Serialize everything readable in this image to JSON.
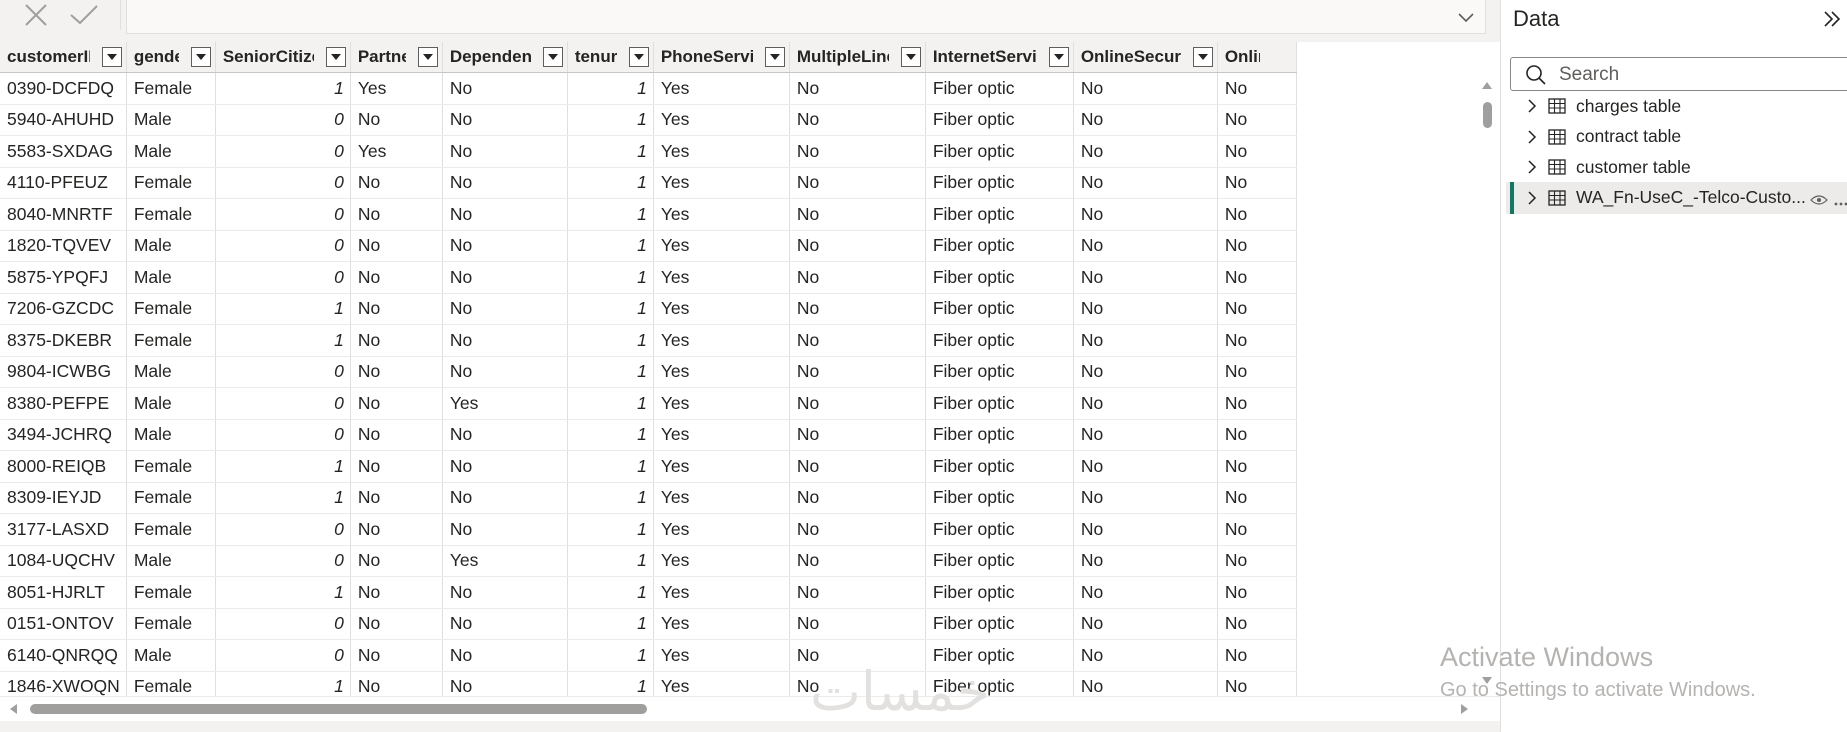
{
  "formula_bar": {
    "cancel_icon": "x-icon",
    "commit_icon": "checkmark-icon",
    "value": ""
  },
  "grid": {
    "columns": [
      "customerID",
      "gender",
      "SeniorCitizen",
      "Partner",
      "Dependents",
      "tenure",
      "PhoneService",
      "MultipleLines",
      "InternetService",
      "OnlineSecurity",
      "OnlineB"
    ],
    "rows": [
      [
        "0390-DCFDQ",
        "Female",
        "1",
        "Yes",
        "No",
        "1",
        "Yes",
        "No",
        "Fiber optic",
        "No",
        "No"
      ],
      [
        "5940-AHUHD",
        "Male",
        "0",
        "No",
        "No",
        "1",
        "Yes",
        "No",
        "Fiber optic",
        "No",
        "No"
      ],
      [
        "5583-SXDAG",
        "Male",
        "0",
        "Yes",
        "No",
        "1",
        "Yes",
        "No",
        "Fiber optic",
        "No",
        "No"
      ],
      [
        "4110-PFEUZ",
        "Female",
        "0",
        "No",
        "No",
        "1",
        "Yes",
        "No",
        "Fiber optic",
        "No",
        "No"
      ],
      [
        "8040-MNRTF",
        "Female",
        "0",
        "No",
        "No",
        "1",
        "Yes",
        "No",
        "Fiber optic",
        "No",
        "No"
      ],
      [
        "1820-TQVEV",
        "Male",
        "0",
        "No",
        "No",
        "1",
        "Yes",
        "No",
        "Fiber optic",
        "No",
        "No"
      ],
      [
        "5875-YPQFJ",
        "Male",
        "0",
        "No",
        "No",
        "1",
        "Yes",
        "No",
        "Fiber optic",
        "No",
        "No"
      ],
      [
        "7206-GZCDC",
        "Female",
        "1",
        "No",
        "No",
        "1",
        "Yes",
        "No",
        "Fiber optic",
        "No",
        "No"
      ],
      [
        "8375-DKEBR",
        "Female",
        "1",
        "No",
        "No",
        "1",
        "Yes",
        "No",
        "Fiber optic",
        "No",
        "No"
      ],
      [
        "9804-ICWBG",
        "Male",
        "0",
        "No",
        "No",
        "1",
        "Yes",
        "No",
        "Fiber optic",
        "No",
        "No"
      ],
      [
        "8380-PEFPE",
        "Male",
        "0",
        "No",
        "Yes",
        "1",
        "Yes",
        "No",
        "Fiber optic",
        "No",
        "No"
      ],
      [
        "3494-JCHRQ",
        "Male",
        "0",
        "No",
        "No",
        "1",
        "Yes",
        "No",
        "Fiber optic",
        "No",
        "No"
      ],
      [
        "8000-REIQB",
        "Female",
        "1",
        "No",
        "No",
        "1",
        "Yes",
        "No",
        "Fiber optic",
        "No",
        "No"
      ],
      [
        "8309-IEYJD",
        "Female",
        "1",
        "No",
        "No",
        "1",
        "Yes",
        "No",
        "Fiber optic",
        "No",
        "No"
      ],
      [
        "3177-LASXD",
        "Female",
        "0",
        "No",
        "No",
        "1",
        "Yes",
        "No",
        "Fiber optic",
        "No",
        "No"
      ],
      [
        "1084-UQCHV",
        "Male",
        "0",
        "No",
        "Yes",
        "1",
        "Yes",
        "No",
        "Fiber optic",
        "No",
        "No"
      ],
      [
        "8051-HJRLT",
        "Female",
        "1",
        "No",
        "No",
        "1",
        "Yes",
        "No",
        "Fiber optic",
        "No",
        "No"
      ],
      [
        "0151-ONTOV",
        "Female",
        "0",
        "No",
        "No",
        "1",
        "Yes",
        "No",
        "Fiber optic",
        "No",
        "No"
      ],
      [
        "6140-QNRQQ",
        "Male",
        "0",
        "No",
        "No",
        "1",
        "Yes",
        "No",
        "Fiber optic",
        "No",
        "No"
      ],
      [
        "1846-XWOQN",
        "Female",
        "1",
        "No",
        "No",
        "1",
        "Yes",
        "No",
        "Fiber optic",
        "No",
        "No"
      ]
    ],
    "numeric_columns": [
      2,
      5
    ]
  },
  "data_pane": {
    "title": "Data",
    "collapse_icon": "double-chevron-right-icon",
    "search_placeholder": "Search",
    "tables": [
      {
        "label": "charges table",
        "selected": false
      },
      {
        "label": "contract table",
        "selected": false
      },
      {
        "label": "customer table",
        "selected": false
      },
      {
        "label": "WA_Fn-UseC_-Telco-Custo...",
        "selected": true
      }
    ]
  },
  "watermark": {
    "line1": "Activate Windows",
    "line2": "Go to Settings to activate Windows."
  },
  "logo_watermark": "خمسات",
  "colors": {
    "selection_accent": "#117865",
    "grid_border": "#e1dfdd",
    "header_bg": "#f3f2f1"
  }
}
